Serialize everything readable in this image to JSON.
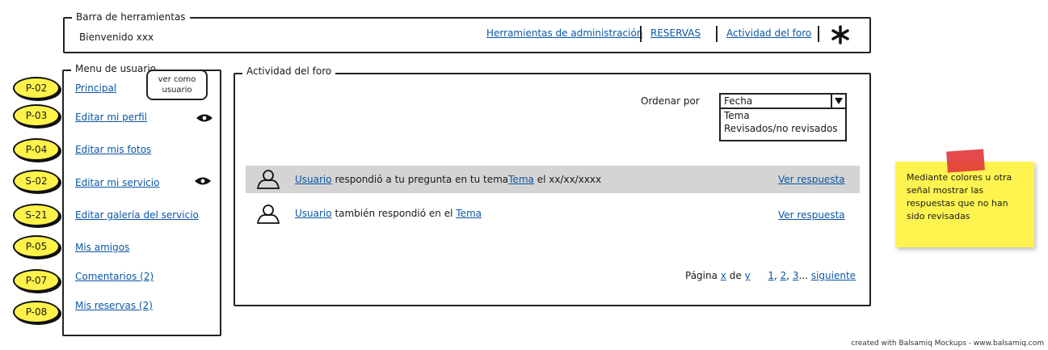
{
  "toolbar": {
    "legend": "Barra de herramientas",
    "welcome": "Bienvenido xxx",
    "links": [
      "Herramientas de administración",
      "RESERVAS",
      "Actividad del foro"
    ]
  },
  "user_menu": {
    "legend": "Menu de usuario",
    "tooltip_line1": "ver como",
    "tooltip_line2": "usuario",
    "items": [
      {
        "badge": "P-02",
        "label": "Principal"
      },
      {
        "badge": "P-03",
        "label": "Editar mi perfil"
      },
      {
        "badge": "P-04",
        "label": "Editar mis fotos"
      },
      {
        "badge": "S-02",
        "label": "Editar mi servicio"
      },
      {
        "badge": "S-21",
        "label": "Editar galería del servicio"
      },
      {
        "badge": "P-05",
        "label": "Mis amigos"
      },
      {
        "badge": "P-07",
        "label": "Comentarios (2)"
      },
      {
        "badge": "P-08",
        "label": "Mis reservas (2)"
      }
    ]
  },
  "forum": {
    "legend": "Actividad del foro",
    "sort_label": "Ordenar por",
    "sort_selected": "Fecha",
    "sort_options": [
      "Tema",
      "Revisados/no revisados"
    ],
    "rows": [
      {
        "user": "Usuario",
        "text1": "respondió a tu pregunta en tu tema",
        "topic": "Tema",
        "text2": "el xx/xx/xxxx",
        "action": "Ver respuesta",
        "highlight": true
      },
      {
        "user": "Usuario",
        "text1": "también respondió en el",
        "topic": "Tema",
        "text2": "",
        "action": "Ver respuesta",
        "highlight": false
      }
    ],
    "pagination": {
      "label": "Página",
      "current": "x",
      "of": "de",
      "total": "y",
      "p1": "1",
      "p2": "2",
      "p3": "3",
      "ellipsis": "...",
      "next": "siguiente"
    }
  },
  "note": {
    "text": "Mediante colores u otra señal mostrar las respuestas que no han sido revisadas",
    "color": "#fff44f"
  },
  "footer": "created with Balsamiq Mockups - www.balsamiq.com",
  "colors": {
    "link": "#0b57a4",
    "badge": "#fff34a",
    "highlight_row": "#d4d4d4",
    "tape": "#e23b3b"
  }
}
